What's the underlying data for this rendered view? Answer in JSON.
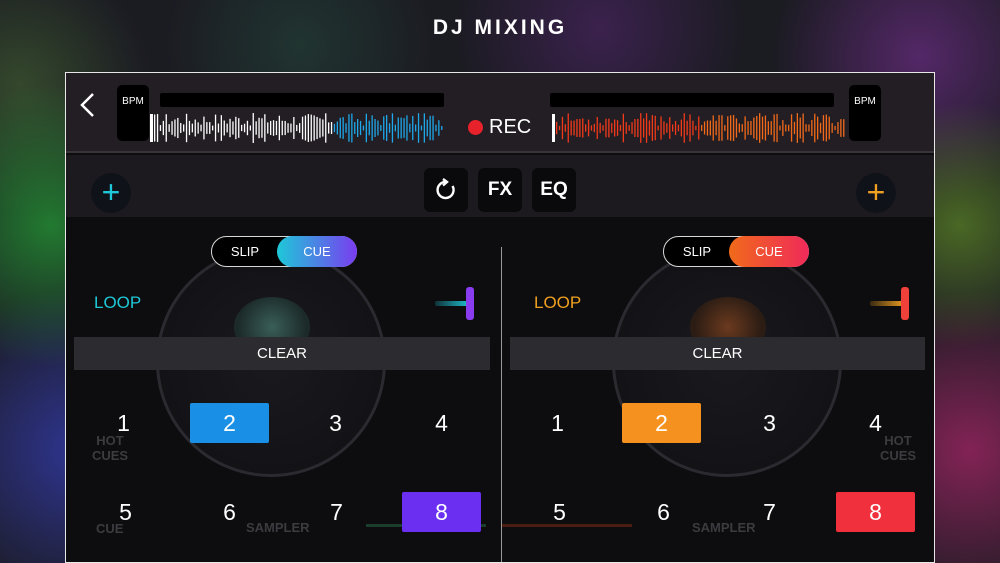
{
  "title": "DJ MIXING",
  "header": {
    "back_icon": "chevron-left-icon",
    "left_bpm_label": "BPM",
    "right_bpm_label": "BPM",
    "rec_label": "REC",
    "rec_color": "#e8222a"
  },
  "controls": {
    "left_add_icon": "plus-icon",
    "right_add_icon": "plus-icon",
    "reset_icon": "rotate-icon",
    "fx_label": "FX",
    "eq_label": "EQ"
  },
  "left_deck": {
    "accent": "#1ec8d8",
    "slip_label": "SLIP",
    "cue_label": "CUE",
    "loop_label": "LOOP",
    "clear_label": "CLEAR",
    "pads": [
      "1",
      "2",
      "3",
      "4",
      "5",
      "6",
      "7",
      "8"
    ],
    "pad2_color": "#1a8fe6",
    "pad8_color": "#6a2ff0",
    "ghost_hot_cues": "HOT\nCUES",
    "ghost_cue": "CUE",
    "ghost_sampler": "SAMPLER"
  },
  "right_deck": {
    "accent": "#f0a020",
    "slip_label": "SLIP",
    "cue_label": "CUE",
    "loop_label": "LOOP",
    "clear_label": "CLEAR",
    "pads": [
      "1",
      "2",
      "3",
      "4",
      "5",
      "6",
      "7",
      "8"
    ],
    "pad2_color": "#f5911e",
    "pad8_color": "#f0303c",
    "ghost_hot_cues": "HOT\nCUES",
    "ghost_sampler": "SAMPLER"
  }
}
